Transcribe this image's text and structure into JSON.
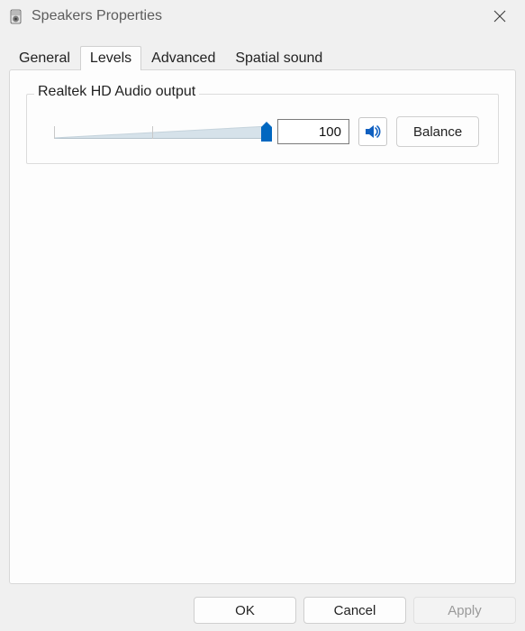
{
  "window": {
    "title": "Speakers Properties"
  },
  "tabs": {
    "items": [
      {
        "label": "General",
        "active": false
      },
      {
        "label": "Levels",
        "active": true
      },
      {
        "label": "Advanced",
        "active": false
      },
      {
        "label": "Spatial sound",
        "active": false
      }
    ]
  },
  "group": {
    "legend": "Realtek HD Audio output",
    "volume_value": "100",
    "slider_percent": 100,
    "mute_state": "unmuted",
    "balance_label": "Balance"
  },
  "buttons": {
    "ok": "OK",
    "cancel": "Cancel",
    "apply": "Apply",
    "apply_enabled": false
  },
  "colors": {
    "accent": "#0067c0",
    "slider_fill": "#d6e2ea",
    "panel_bg": "#fdfdfd",
    "window_bg": "#f0f0f0"
  }
}
